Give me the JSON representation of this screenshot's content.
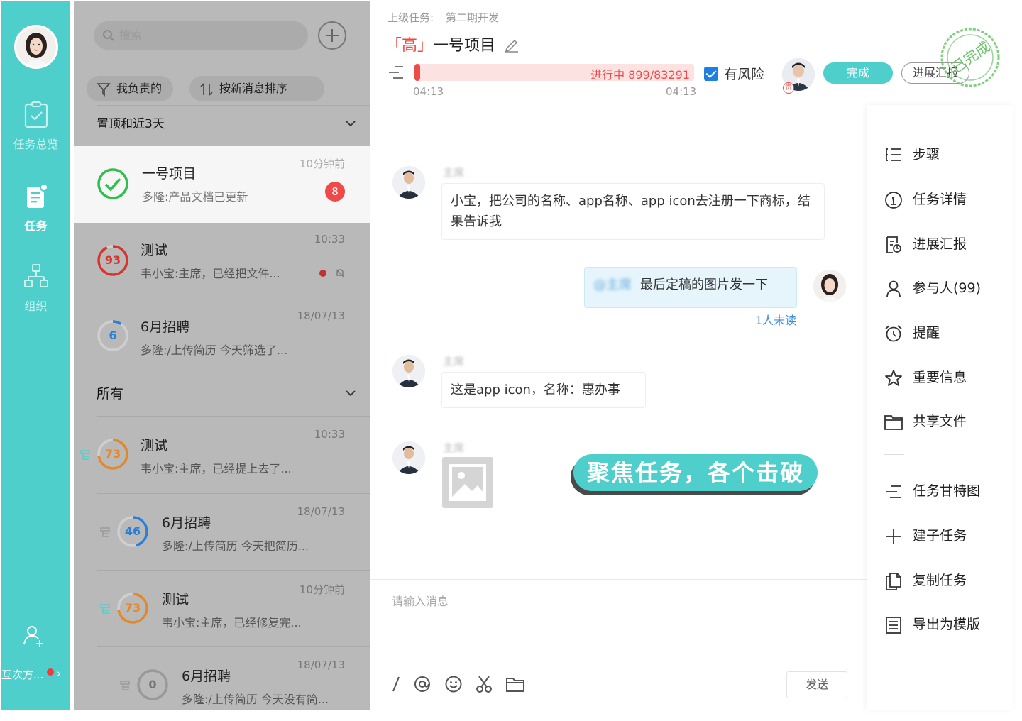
{
  "rail": {
    "items": [
      {
        "label": "任务总览",
        "icon": "clipboard-check-icon"
      },
      {
        "label": "任务",
        "icon": "task-list-icon"
      },
      {
        "label": "组织",
        "icon": "org-tree-icon"
      }
    ],
    "bottom_label": "互次方...",
    "bottom_icon": "add-user-icon"
  },
  "list": {
    "search_placeholder": "搜索",
    "filters": [
      {
        "label": "我负责的",
        "icon": "filter-icon"
      },
      {
        "label": "按新消息排序",
        "icon": "sort-icon"
      }
    ],
    "pinned_section": "置顶和近3天",
    "all_section": "所有",
    "pinned": [
      {
        "title": "一号项目",
        "sub": "多隆:产品文档已更新",
        "time": "10分钟前",
        "badge": "8",
        "status": "done",
        "ring_value": "",
        "color": "#2fbf4c"
      },
      {
        "title": "测试",
        "sub": "韦小宝:主席，已经把文件...",
        "time": "10:33",
        "ring_value": "93",
        "color": "#d9342c"
      },
      {
        "title": "6月招聘",
        "sub": "多隆:/上传简历 今天筛选了...",
        "time": "18/07/13",
        "ring_value": "6",
        "color": "#2d7fd4"
      }
    ],
    "all": [
      {
        "title": "测试",
        "sub": "韦小宝:主席，已经提上去了...",
        "time": "10:33",
        "ring_value": "73",
        "color": "#e0892a"
      },
      {
        "title": "6月招聘",
        "sub": "多隆:/上传简历 今天把简历...",
        "time": "18/07/13",
        "ring_value": "46",
        "color": "#2d7fd4"
      },
      {
        "title": "测试",
        "sub": "韦小宝:主席，已经修复完...",
        "time": "10分钟前",
        "ring_value": "73",
        "color": "#e0892a"
      },
      {
        "title": "6月招聘",
        "sub": "多隆:/上传简历 今天没有简...",
        "time": "18/07/13",
        "ring_value": "0",
        "color": "#999999"
      }
    ]
  },
  "task": {
    "parent_label": "上级任务:",
    "parent_name": "第二期开发",
    "priority": "「高」",
    "title": "一号项目",
    "progress_text": "进行中 899/83291",
    "progress_fraction": 0.011,
    "start_time": "04:13",
    "end_time": "04:13",
    "risk_label": "有风险",
    "risk_checked": true,
    "owner_tag": "责",
    "done_button": "完成",
    "report_button": "进展汇报",
    "stamp_text": "已完成"
  },
  "messages": [
    {
      "sender": "主席",
      "text": "小宝，把公司的名称、app名称、app icon去注册一下商标，结果告诉我",
      "mine": false
    },
    {
      "sender": "me",
      "mention": "@主席",
      "text": "最后定稿的图片发一下",
      "mine": true,
      "read_status": "1人未读"
    },
    {
      "sender": "主席",
      "text": "这是app icon，名称：惠办事",
      "mine": false
    },
    {
      "sender": "主席",
      "image": "image-placeholder-icon",
      "mine": false
    }
  ],
  "banner": "聚焦任务，各个击破",
  "composer": {
    "placeholder": "请输入消息",
    "tools": [
      "slash-command-icon",
      "at-mention-icon",
      "emoji-icon",
      "scissors-icon",
      "folder-icon"
    ],
    "send_label": "发送"
  },
  "actions": [
    {
      "label": "步骤",
      "icon": "steps-list-icon"
    },
    {
      "label": "任务详情",
      "icon": "info-icon"
    },
    {
      "label": "进展汇报",
      "icon": "report-icon"
    },
    {
      "label": "参与人(99)",
      "icon": "person-icon"
    },
    {
      "label": "提醒",
      "icon": "alarm-clock-icon"
    },
    {
      "label": "重要信息",
      "icon": "star-icon"
    },
    {
      "label": "共享文件",
      "icon": "folder-icon"
    },
    {
      "label": "任务甘特图",
      "icon": "gantt-icon"
    },
    {
      "label": "建子任务",
      "icon": "plus-icon"
    },
    {
      "label": "复制任务",
      "icon": "copy-icon"
    },
    {
      "label": "导出为模版",
      "icon": "template-icon"
    }
  ],
  "colors": {
    "accent": "#4fcfcb",
    "danger": "#ef4a4a",
    "link": "#3b8fd9"
  }
}
